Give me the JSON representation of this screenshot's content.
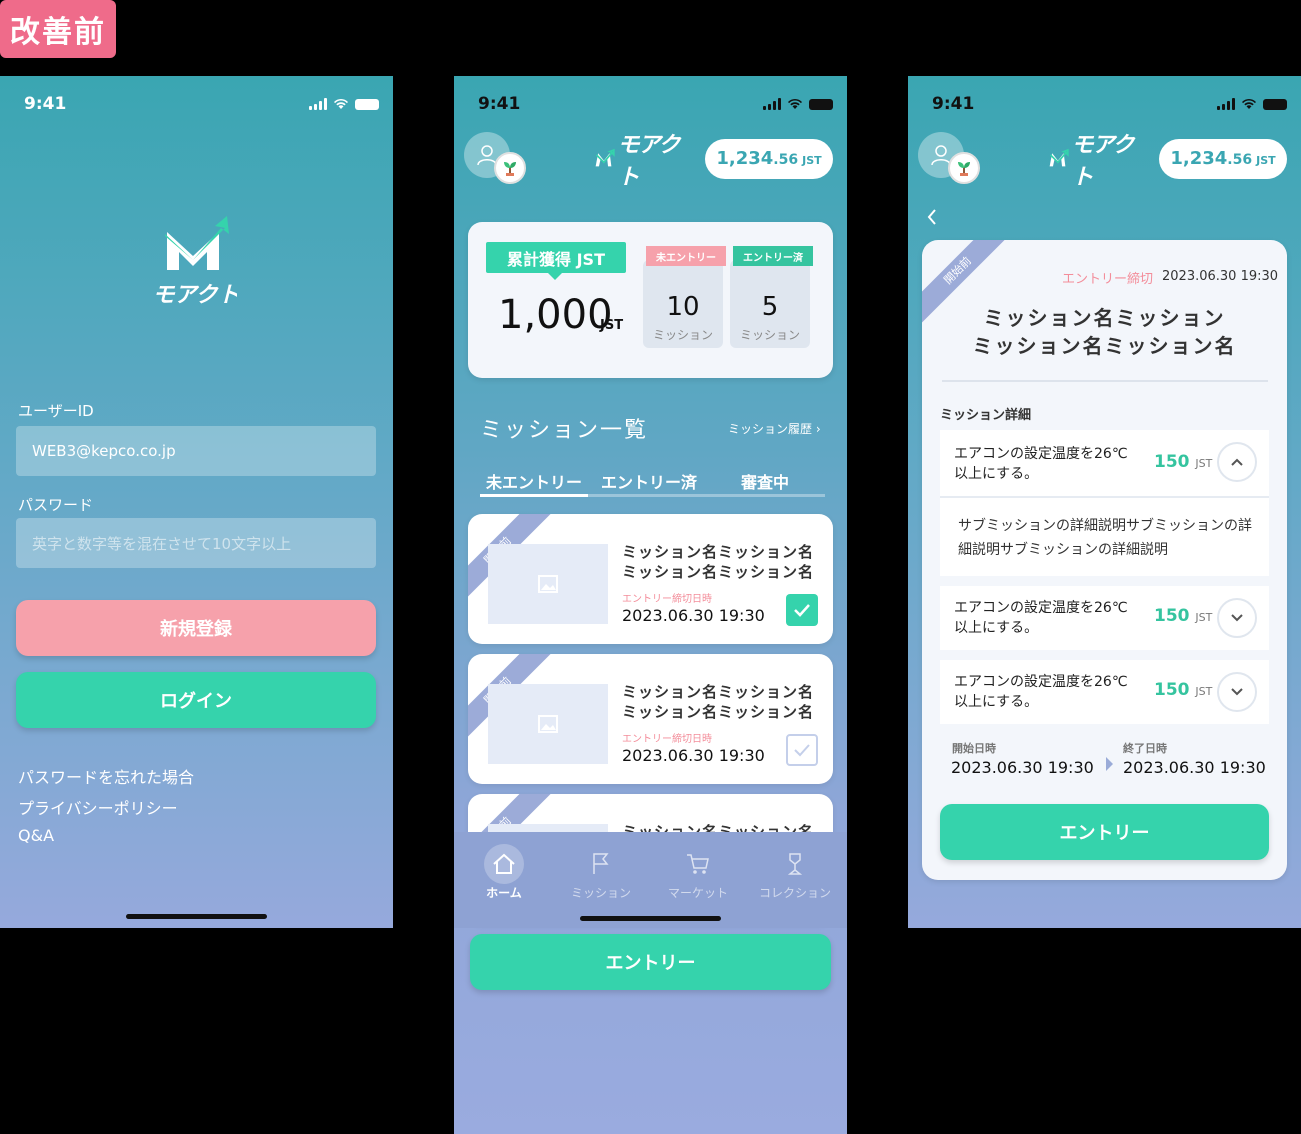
{
  "tag": "改善前",
  "status": {
    "time": "9:41"
  },
  "login": {
    "brand": "モアクト",
    "user_label": "ユーザーID",
    "user_value": "WEB3@kepco.co.jp",
    "pass_label": "パスワード",
    "pass_placeholder": "英字と数字等を混在させて10文字以上",
    "register_label": "新規登録",
    "login_label": "ログイン",
    "links": [
      "パスワードを忘れた場合",
      "プライバシーポリシー",
      "Q&A"
    ]
  },
  "header": {
    "brand": "モアクト",
    "balance_int": "1,234",
    "balance_dec": ".56",
    "balance_unit": "JST"
  },
  "summary": {
    "title": "累計獲得 JST",
    "value": "1,000",
    "unit": "JST",
    "boxes": [
      {
        "head": "未エントリー",
        "count": "10",
        "sub": "ミッション",
        "color": "#f6a1ab"
      },
      {
        "head": "エントリー済",
        "count": "5",
        "sub": "ミッション",
        "color": "#35c49f"
      }
    ]
  },
  "missions": {
    "title": "ミッション一覧",
    "history": "ミッション履歴",
    "tabs": [
      "未エントリー",
      "エントリー済",
      "審査中"
    ],
    "items": [
      {
        "ribbon": "開始前",
        "title": "ミッション名ミッション名ミッション名ミッション名",
        "deadline_label": "エントリー締切日時",
        "deadline": "2023.06.30 19:30",
        "checked": true
      },
      {
        "ribbon": "開始前",
        "title": "ミッション名ミッション名ミッション名ミッション名",
        "deadline_label": "エントリー締切日時",
        "deadline": "2023.06.30 19:30",
        "checked": false
      },
      {
        "ribbon": "開始前",
        "title": "ミッション名ミッション名",
        "deadline_label": "",
        "deadline": "",
        "checked": false
      }
    ]
  },
  "nav": [
    {
      "label": "ホーム",
      "icon": "home-icon",
      "active": true
    },
    {
      "label": "ミッション",
      "icon": "flag-icon",
      "active": false
    },
    {
      "label": "マーケット",
      "icon": "cart-icon",
      "active": false
    },
    {
      "label": "コレクション",
      "icon": "trophy-icon",
      "active": false
    }
  ],
  "entry_label": "エントリー",
  "detail": {
    "ribbon": "開始前",
    "deadline_label": "エントリー締切",
    "deadline": "2023.06.30 19:30",
    "title_l1": "ミッション名ミッション",
    "title_l2": "ミッション名ミッション名",
    "section": "ミッション詳細",
    "subs": [
      {
        "l1": "エアコンの設定温度を26℃",
        "l2": "以上にする。",
        "points": "150",
        "unit": "JST",
        "expanded": true,
        "desc": "サブミッションの詳細説明サブミッションの詳細説明サブミッションの詳細説明"
      },
      {
        "l1": "エアコンの設定温度を26℃",
        "l2": "以上にする。",
        "points": "150",
        "unit": "JST",
        "expanded": false
      },
      {
        "l1": "エアコンの設定温度を26℃",
        "l2": "以上にする。",
        "points": "150",
        "unit": "JST",
        "expanded": false
      }
    ],
    "start_label": "開始日時",
    "start": "2023.06.30 19:30",
    "end_label": "終了日時",
    "end": "2023.06.30 19:30"
  }
}
